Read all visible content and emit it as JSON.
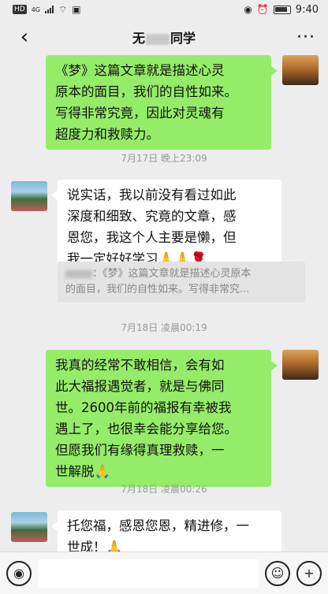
{
  "status_bar": {
    "network_badge": "HD",
    "network_type": "4G",
    "time": "9:40"
  },
  "header": {
    "title_left": "无",
    "title_right": "同学",
    "more_label": "···"
  },
  "messages": [
    {
      "side": "right",
      "text_lines": [
        "《梦》这篇文章就是描述心灵",
        "原本的面目，我们的自性如来。",
        "写得非常究竟，因此对灵魂有",
        "超度力和救赎力。"
      ]
    },
    {
      "time": "7月17日 晚上23:09"
    },
    {
      "side": "left",
      "text_lines": [
        "说实话，我以前没有看过如此",
        "深度和细致、究竟的文章，感",
        "恩您，我这个人主要是懒，但",
        "我一定好好学习🙏🙏🌹"
      ],
      "quote_lines": [
        "：《梦》这篇文章就是描述心灵原本",
        "的面目，我们的自性如来。写得非常究..."
      ]
    },
    {
      "time": "7月18日 凌晨00:19"
    },
    {
      "side": "right",
      "text_lines": [
        "我真的经常不敢相信，会有如",
        "此大福报遇觉者，就是与佛同",
        "世。2600年前的福报有幸被我",
        "遇上了，也很幸会能分享给您。",
        "但愿我们有缘得真理救赎，一",
        "世解脱🙏"
      ]
    },
    {
      "time": "7月18日 凌晨00:26"
    },
    {
      "side": "left",
      "text_lines": [
        "托您福，感恩您恩，精进修，一",
        "世成！🙏"
      ]
    }
  ],
  "input_bar": {
    "voice_icon_glyph": "◉",
    "emoji_icon_glyph": "☺",
    "add_icon_glyph": "+"
  },
  "colors": {
    "background": "#ededed",
    "sent_bubble": "#95ec69",
    "received_bubble": "#ffffff",
    "time_label": "#999999"
  }
}
